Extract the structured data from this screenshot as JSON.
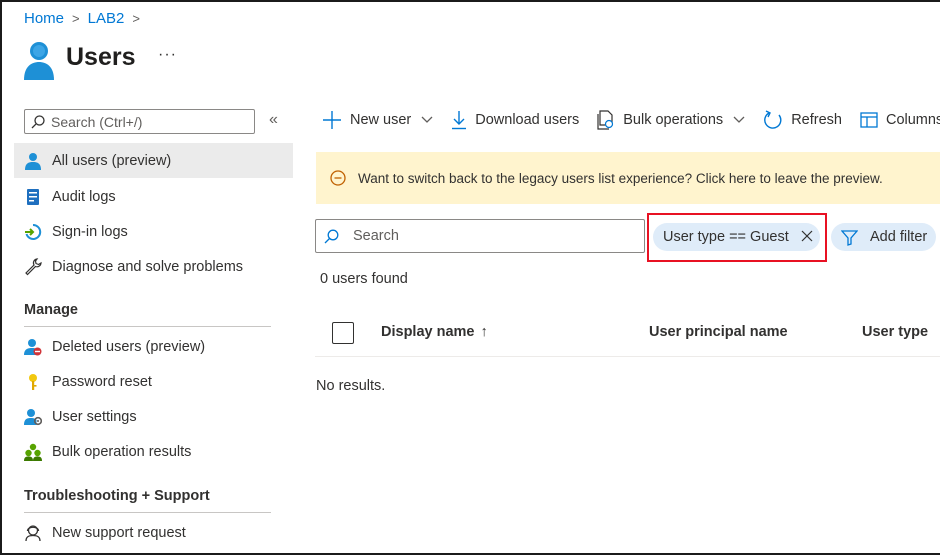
{
  "breadcrumb": {
    "home": "Home",
    "tenant": "LAB2",
    "sep": ">"
  },
  "page": {
    "title": "Users",
    "more": "···"
  },
  "sidebar": {
    "search_placeholder": "Search (Ctrl+/)",
    "collapse": "«",
    "items": [
      {
        "label": "All users (preview)",
        "icon": "user-icon",
        "active": true
      },
      {
        "label": "Audit logs",
        "icon": "audit-log-icon"
      },
      {
        "label": "Sign-in logs",
        "icon": "sign-in-icon"
      },
      {
        "label": "Diagnose and solve problems",
        "icon": "wrench-icon"
      }
    ],
    "manage_title": "Manage",
    "manage_items": [
      {
        "label": "Deleted users (preview)",
        "icon": "deleted-user-icon"
      },
      {
        "label": "Password reset",
        "icon": "key-icon"
      },
      {
        "label": "User settings",
        "icon": "user-settings-icon"
      },
      {
        "label": "Bulk operation results",
        "icon": "bulk-results-icon"
      }
    ],
    "support_title": "Troubleshooting + Support",
    "support_items": [
      {
        "label": "New support request",
        "icon": "support-icon"
      }
    ]
  },
  "toolbar": {
    "new_user": "New user",
    "download_users": "Download users",
    "bulk_operations": "Bulk operations",
    "refresh": "Refresh",
    "columns": "Columns"
  },
  "banner": {
    "text": "Want to switch back to the legacy users list experience? Click here to leave the preview."
  },
  "search": {
    "placeholder": "Search"
  },
  "filters": {
    "active": "User type == Guest",
    "add": "Add filter"
  },
  "results": {
    "count_text": "0 users found",
    "empty_text": "No results."
  },
  "table": {
    "columns": [
      "Display name",
      "User principal name",
      "User type"
    ],
    "sort_indicator": "↑"
  },
  "colors": {
    "accent": "#0078d4",
    "banner_bg": "#fff4ce",
    "pill_bg": "#dfecf9",
    "highlight": "#e81123"
  }
}
